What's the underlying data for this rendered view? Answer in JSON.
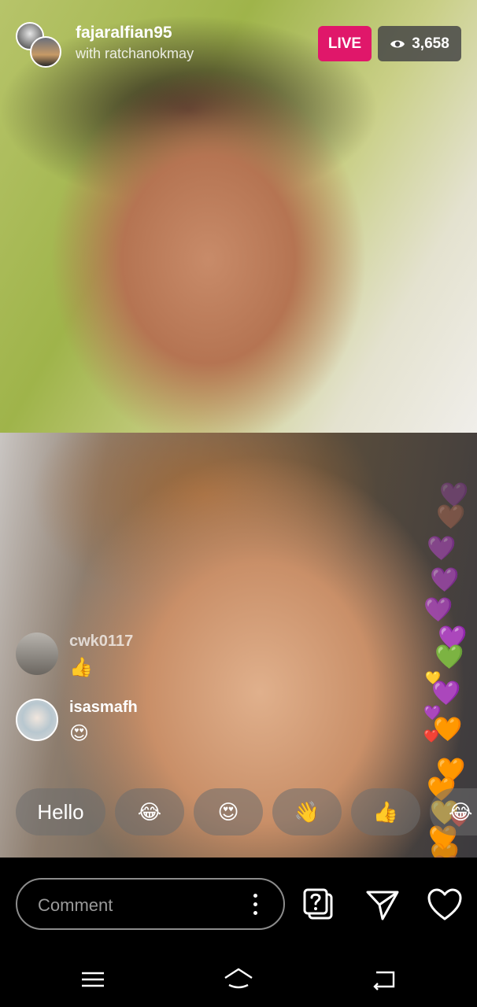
{
  "header": {
    "host_username": "fajaralfian95",
    "guest_line": "with ratchanokmay",
    "live_label": "LIVE",
    "viewer_count": "3,658"
  },
  "comments": [
    {
      "username": "cwk0117",
      "text": "👍"
    },
    {
      "username": "isasmafh",
      "text": "😍"
    }
  ],
  "quick_replies": [
    "Hello",
    "😂",
    "😍",
    "👋",
    "👍",
    "😂"
  ],
  "hearts": [
    "💜",
    "🤎",
    "💜",
    "💜",
    "💜",
    "💜",
    "💚",
    "💛",
    "💜",
    "💜",
    "🧡",
    "❤️",
    "🧡",
    "🧡",
    "💛",
    "🧡",
    "❤️",
    "🧡",
    "🤎"
  ],
  "composer": {
    "placeholder": "Comment"
  },
  "colors": {
    "live": "#e0176a",
    "badge": "#464646",
    "background": "#000000"
  },
  "icons": [
    "more-options-icon",
    "question-sticker-icon",
    "send-icon",
    "heart-outline-icon",
    "menu-icon",
    "home-icon",
    "back-icon",
    "eye-icon"
  ]
}
